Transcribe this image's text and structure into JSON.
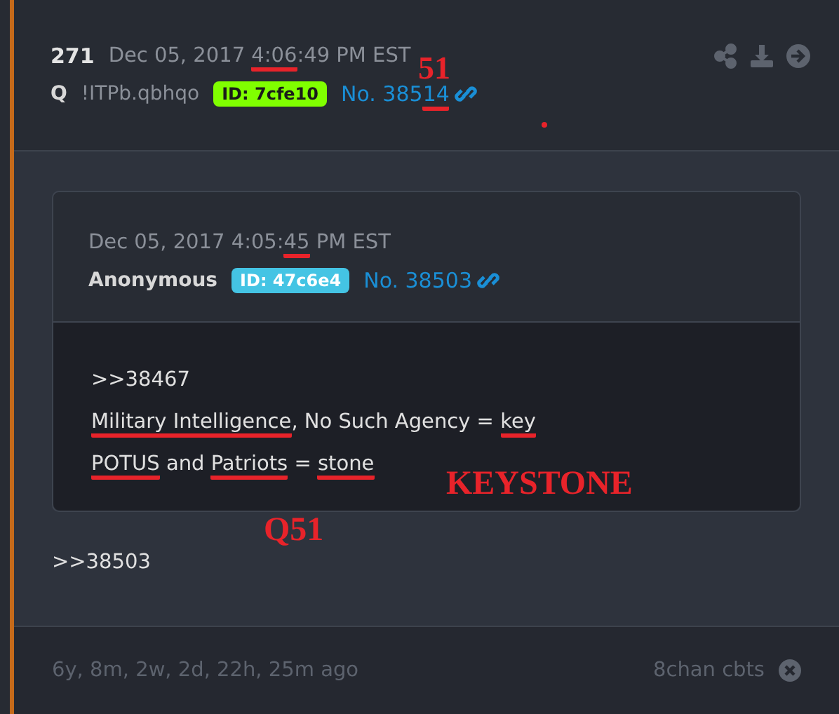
{
  "post": {
    "number": "271",
    "date": [
      {
        "text": "Dec 05, 2017 ",
        "marked": false
      },
      {
        "text": "4:06",
        "marked": true
      },
      {
        "text": ":49 PM EST",
        "marked": false
      }
    ],
    "author": "Q",
    "tripcode": "!ITPb.qbhqo",
    "id_badge": {
      "text": "ID: 7cfe10",
      "color": "#80ff00"
    },
    "link": [
      {
        "text": "No. 385",
        "marked": false
      },
      {
        "text": "14",
        "marked": true
      }
    ],
    "quote": {
      "date": [
        {
          "text": "Dec 05, 2017 4:05:",
          "marked": false
        },
        {
          "text": "45",
          "marked": true
        },
        {
          "text": " PM EST",
          "marked": false
        }
      ],
      "name": "Anonymous",
      "id_badge": {
        "text": "ID: 47c6e4",
        "color": "#44c4e4"
      },
      "link": "No. 38503",
      "lines": [
        [
          {
            "text": ">>38467",
            "marked": false
          }
        ],
        [
          {
            "text": "Military Intelligence",
            "marked": true
          },
          {
            "text": ", No Such Agency = ",
            "marked": false
          },
          {
            "text": "key",
            "marked": true
          }
        ],
        [
          {
            "text": "POTUS",
            "marked": true
          },
          {
            "text": " and ",
            "marked": false
          },
          {
            "text": "Patriots",
            "marked": true
          },
          {
            "text": " = ",
            "marked": false
          },
          {
            "text": "stone",
            "marked": true
          }
        ]
      ]
    },
    "reply": ">>38503",
    "age": "6y, 8m, 2w, 2d, 22h, 25m ago",
    "source": "8chan cbts"
  },
  "annotations": [
    "51",
    "KEYSTONE",
    "Q51"
  ]
}
